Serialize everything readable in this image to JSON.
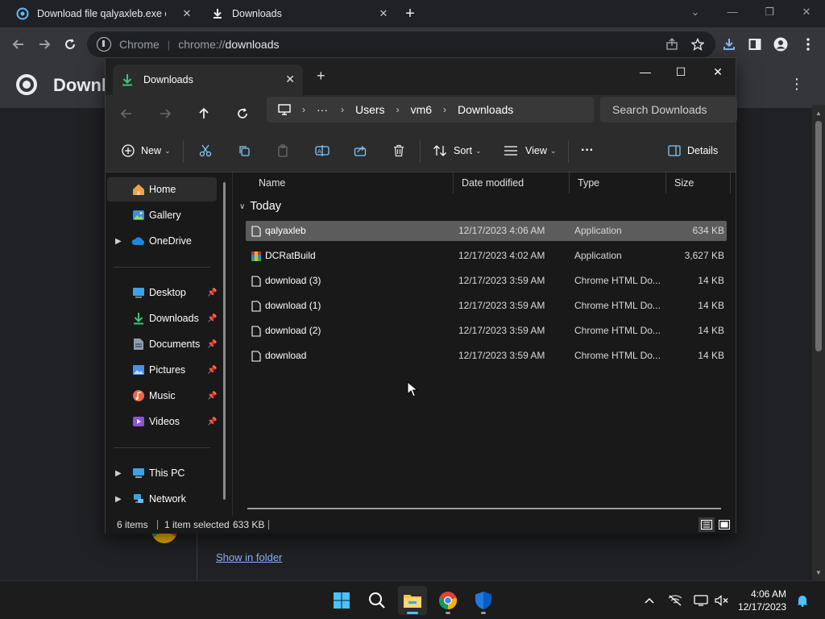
{
  "chrome": {
    "tabs": [
      {
        "title": "Download file qalyaxleb.exe on C",
        "icon": "download-site-favicon"
      },
      {
        "title": "Downloads",
        "icon": "download-icon"
      }
    ],
    "site_label": "Chrome",
    "url_prefix": "chrome://",
    "url_path": "downloads",
    "page_title": "Downloads",
    "show_in_folder": "Show in folder"
  },
  "explorer": {
    "tab_title": "Downloads",
    "breadcrumb": [
      "Users",
      "vm6",
      "Downloads"
    ],
    "breadcrumb_more": "···",
    "search_placeholder": "Search Downloads",
    "commands": {
      "new": "New",
      "sort": "Sort",
      "view": "View",
      "details": "Details",
      "more": "···"
    },
    "nav_items": [
      {
        "label": "Home",
        "icon": "home-icon",
        "selected": true
      },
      {
        "label": "Gallery",
        "icon": "gallery-icon"
      },
      {
        "label": "OneDrive",
        "icon": "onedrive-icon",
        "expandable": true
      },
      {
        "label": "Desktop",
        "icon": "desktop-icon",
        "pinned": true
      },
      {
        "label": "Downloads",
        "icon": "downloads-icon",
        "pinned": true
      },
      {
        "label": "Documents",
        "icon": "documents-icon",
        "pinned": true
      },
      {
        "label": "Pictures",
        "icon": "pictures-icon",
        "pinned": true
      },
      {
        "label": "Music",
        "icon": "music-icon",
        "pinned": true
      },
      {
        "label": "Videos",
        "icon": "videos-icon",
        "pinned": true
      },
      {
        "label": "This PC",
        "icon": "this-pc-icon",
        "expandable": true
      },
      {
        "label": "Network",
        "icon": "network-icon",
        "expandable": true
      }
    ],
    "columns": [
      "Name",
      "Date modified",
      "Type",
      "Size"
    ],
    "group": "Today",
    "files": [
      {
        "name": "qalyaxleb",
        "date": "12/17/2023 4:06 AM",
        "type": "Application",
        "size": "634 KB",
        "selected": true,
        "icon": "file-icon"
      },
      {
        "name": "DCRatBuild",
        "date": "12/17/2023 4:02 AM",
        "type": "Application",
        "size": "3,627 KB",
        "icon": "winrar-icon"
      },
      {
        "name": "download (3)",
        "date": "12/17/2023 3:59 AM",
        "type": "Chrome HTML Do...",
        "size": "14 KB",
        "icon": "file-icon"
      },
      {
        "name": "download (1)",
        "date": "12/17/2023 3:59 AM",
        "type": "Chrome HTML Do...",
        "size": "14 KB",
        "icon": "file-icon"
      },
      {
        "name": "download (2)",
        "date": "12/17/2023 3:59 AM",
        "type": "Chrome HTML Do...",
        "size": "14 KB",
        "icon": "file-icon"
      },
      {
        "name": "download",
        "date": "12/17/2023 3:59 AM",
        "type": "Chrome HTML Do...",
        "size": "14 KB",
        "icon": "file-icon"
      }
    ],
    "status": {
      "items": "6 items",
      "selected": "1 item selected",
      "size": "633 KB"
    }
  },
  "taskbar": {
    "time": "4:06 AM",
    "date": "12/17/2023"
  },
  "colors": {
    "accent": "#5cbcff",
    "link": "#8ab4f8",
    "folder_yellow": "#f8c64a"
  }
}
